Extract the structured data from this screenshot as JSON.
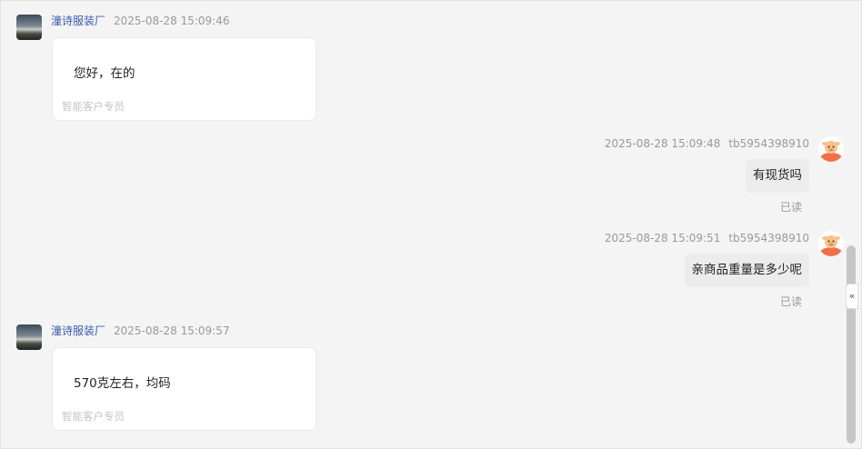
{
  "messages": [
    {
      "side": "left",
      "sender": "潼诗服装厂",
      "time": "2025-08-28 15:09:46",
      "text": "您好，在的",
      "sub": "智能客户专员"
    },
    {
      "side": "right",
      "time": "2025-08-28 15:09:48",
      "user": "tb5954398910",
      "text": "有现货吗",
      "status": "已读"
    },
    {
      "side": "right",
      "time": "2025-08-28 15:09:51",
      "user": "tb5954398910",
      "text": "亲商品重量是多少呢",
      "status": "已读"
    },
    {
      "side": "left",
      "sender": "潼诗服装厂",
      "time": "2025-08-28 15:09:57",
      "text": "570克左右，均码",
      "sub": "智能客户专员"
    }
  ],
  "panel": {
    "collapse_icon": "«"
  },
  "colors": {
    "sender_name": "#3b5bb0",
    "meta_text": "#999999",
    "bubble_bg": "#ececec",
    "page_bg": "#f4f4f4"
  }
}
